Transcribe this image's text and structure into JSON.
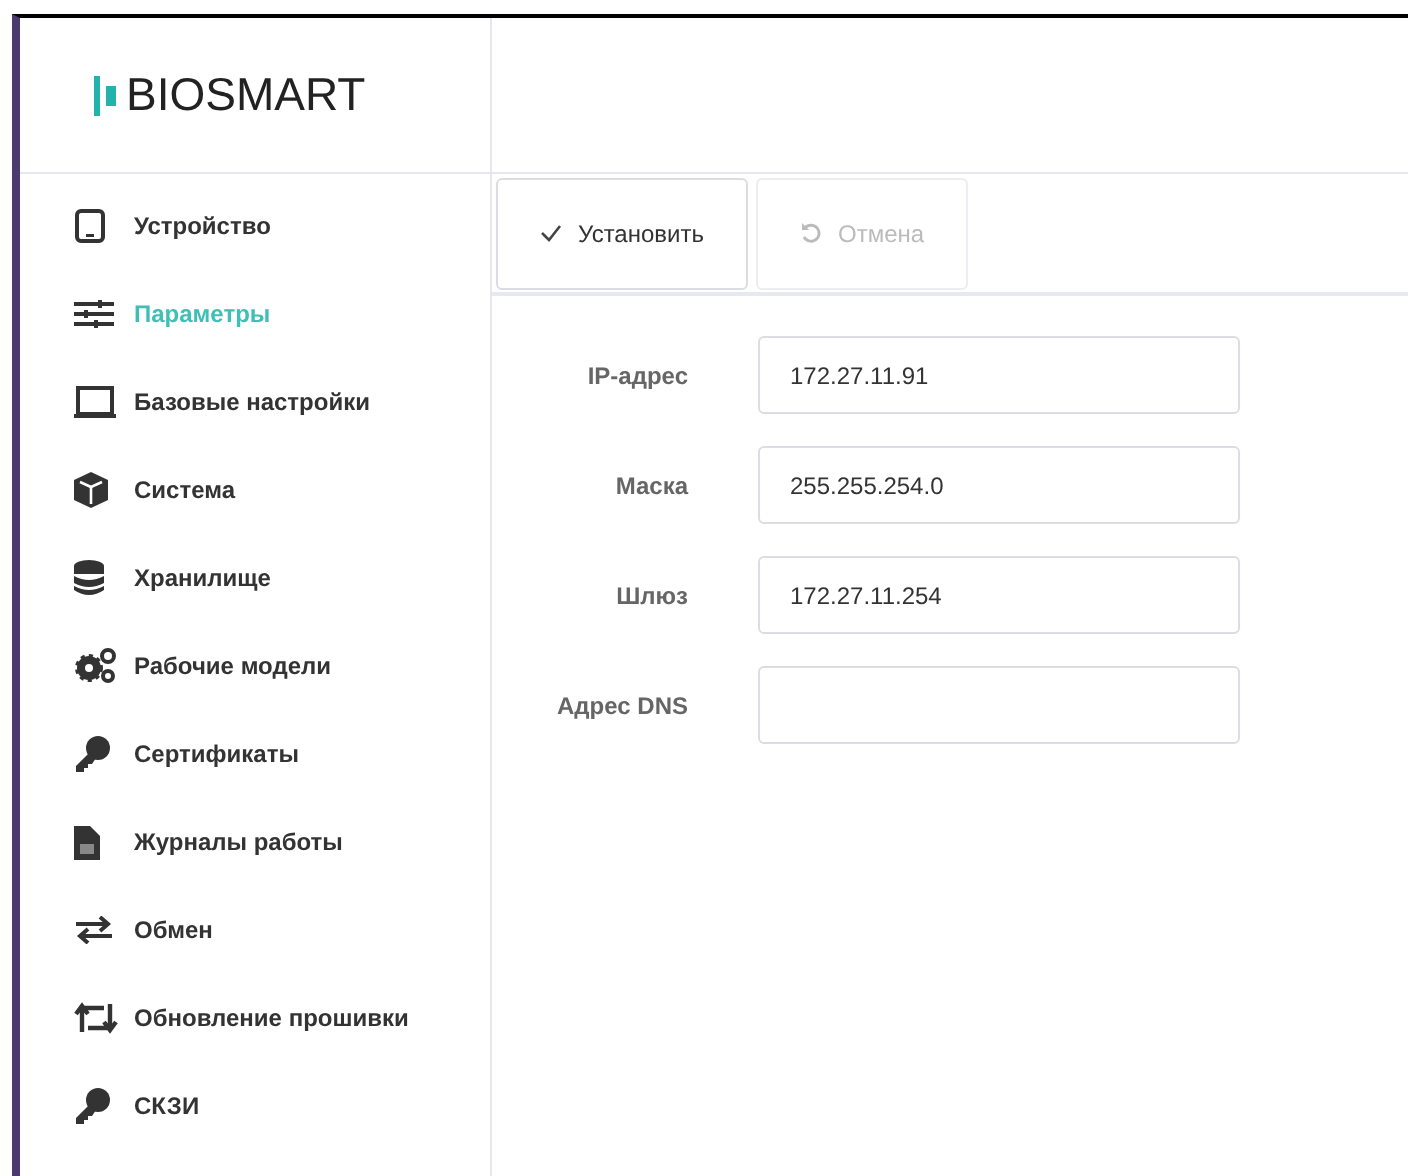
{
  "logo": {
    "text": "BIOSMART"
  },
  "sidebar": {
    "items": [
      {
        "label": "Устройство",
        "selected": false
      },
      {
        "label": "Параметры",
        "selected": true
      },
      {
        "label": "Базовые настройки",
        "selected": false
      },
      {
        "label": "Система",
        "selected": false
      },
      {
        "label": "Хранилище",
        "selected": false
      },
      {
        "label": "Рабочие модели",
        "selected": false
      },
      {
        "label": "Сертификаты",
        "selected": false
      },
      {
        "label": "Журналы работы",
        "selected": false
      },
      {
        "label": "Обмен",
        "selected": false
      },
      {
        "label": "Обновление прошивки",
        "selected": false
      },
      {
        "label": "СКЗИ",
        "selected": false
      }
    ]
  },
  "toolbar": {
    "buttons": [
      {
        "label": "Установить",
        "disabled": false
      },
      {
        "label": "Отмена",
        "disabled": true
      }
    ]
  },
  "form": {
    "fields": [
      {
        "label": "IP-адрес",
        "value": "172.27.11.91"
      },
      {
        "label": "Маска",
        "value": "255.255.254.0"
      },
      {
        "label": "Шлюз",
        "value": "172.27.11.254"
      },
      {
        "label": "Адрес DNS"
      }
    ]
  }
}
